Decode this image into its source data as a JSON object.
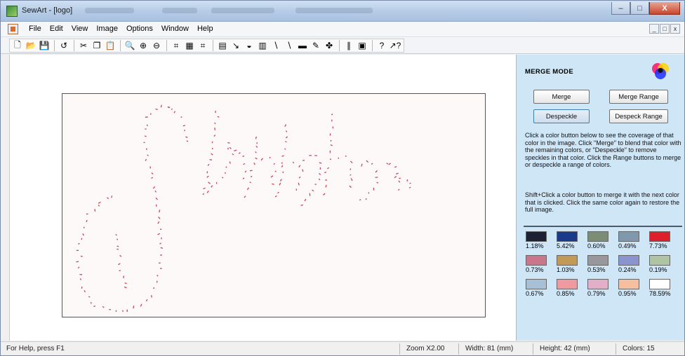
{
  "window": {
    "title": "SewArt - [logo]",
    "controls": {
      "minimize": "–",
      "maximize": "□",
      "close": "X"
    }
  },
  "menubar": {
    "items": [
      "File",
      "Edit",
      "View",
      "Image",
      "Options",
      "Window",
      "Help"
    ],
    "mdi_controls": [
      "_",
      "□",
      "x"
    ]
  },
  "toolbar": {
    "tools": [
      {
        "name": "new",
        "glyph": "🗋"
      },
      {
        "name": "open",
        "glyph": "📂"
      },
      {
        "name": "save",
        "glyph": "💾"
      },
      {
        "sep": true
      },
      {
        "name": "undo",
        "glyph": "↺"
      },
      {
        "sep": true
      },
      {
        "name": "cut",
        "glyph": "✂"
      },
      {
        "name": "copy",
        "glyph": "❐"
      },
      {
        "name": "paste",
        "glyph": "📋"
      },
      {
        "sep": true
      },
      {
        "name": "zoom-fit",
        "glyph": "🔍"
      },
      {
        "name": "zoom-in",
        "glyph": "⊕"
      },
      {
        "name": "zoom-out",
        "glyph": "⊖"
      },
      {
        "sep": true
      },
      {
        "name": "crop",
        "glyph": "⌗"
      },
      {
        "name": "resize",
        "glyph": "▦"
      },
      {
        "name": "grid",
        "glyph": "⌗"
      },
      {
        "sep": true
      },
      {
        "name": "posterize",
        "glyph": "▤"
      },
      {
        "name": "wand",
        "glyph": "↘"
      },
      {
        "name": "fill",
        "glyph": "◒"
      },
      {
        "name": "merge",
        "glyph": "▥"
      },
      {
        "name": "pen",
        "glyph": "∖"
      },
      {
        "name": "line",
        "glyph": "∖"
      },
      {
        "name": "eraser",
        "glyph": "▬"
      },
      {
        "name": "pencil",
        "glyph": "✎"
      },
      {
        "name": "stitch",
        "glyph": "✤"
      },
      {
        "sep": true
      },
      {
        "name": "columns",
        "glyph": "∥"
      },
      {
        "name": "sewing-machine",
        "glyph": "▣"
      },
      {
        "sep": true
      },
      {
        "name": "help",
        "glyph": "?"
      },
      {
        "name": "context-help",
        "glyph": "↗?"
      }
    ]
  },
  "panel": {
    "title": "MERGE MODE",
    "buttons": {
      "merge": "Merge",
      "merge_range": "Merge Range",
      "despeckle": "Despeckle",
      "despeck_range": "Despeck Range"
    },
    "help_1": "Click a color button below to see the coverage of that color in the image. Click \"Merge\" to blend that color with the remaining colors, or \"Despeckle\" to remove speckles in that color. Click the Range buttons to merge or despeckle a range of colors.",
    "help_2": "Shift+Click a color button to merge it with the next color that is clicked. Click the same color again to restore the full image.",
    "swatches": [
      [
        {
          "color": "#1c2233",
          "pct": "1.18%"
        },
        {
          "color": "#1a3a8c",
          "pct": "5.42%"
        },
        {
          "color": "#7c8d76",
          "pct": "0.60%"
        },
        {
          "color": "#7f98ad",
          "pct": "0.49%"
        },
        {
          "color": "#dc1f2a",
          "pct": "7.73%"
        }
      ],
      [
        {
          "color": "#c9758c",
          "pct": "0.73%"
        },
        {
          "color": "#c29a56",
          "pct": "1.03%"
        },
        {
          "color": "#98979b",
          "pct": "0.53%"
        },
        {
          "color": "#8a94cf",
          "pct": "0.24%"
        },
        {
          "color": "#adc5a2",
          "pct": "0.19%"
        }
      ],
      [
        {
          "color": "#a8c0d6",
          "pct": "0.67%"
        },
        {
          "color": "#ef9aa0",
          "pct": "0.85%"
        },
        {
          "color": "#e2aec8",
          "pct": "0.79%"
        },
        {
          "color": "#f6bfa0",
          "pct": "0.95%"
        },
        {
          "color": "#ffffff",
          "pct": "78.59%"
        }
      ]
    ]
  },
  "status": {
    "help": "For Help, press F1",
    "zoom": "Zoom X2.00",
    "width": "Width: 81 (mm)",
    "height": "Height: 42 (mm)",
    "colors": "Colors: 15"
  },
  "image": {
    "stitch_color": "#c4485a"
  }
}
